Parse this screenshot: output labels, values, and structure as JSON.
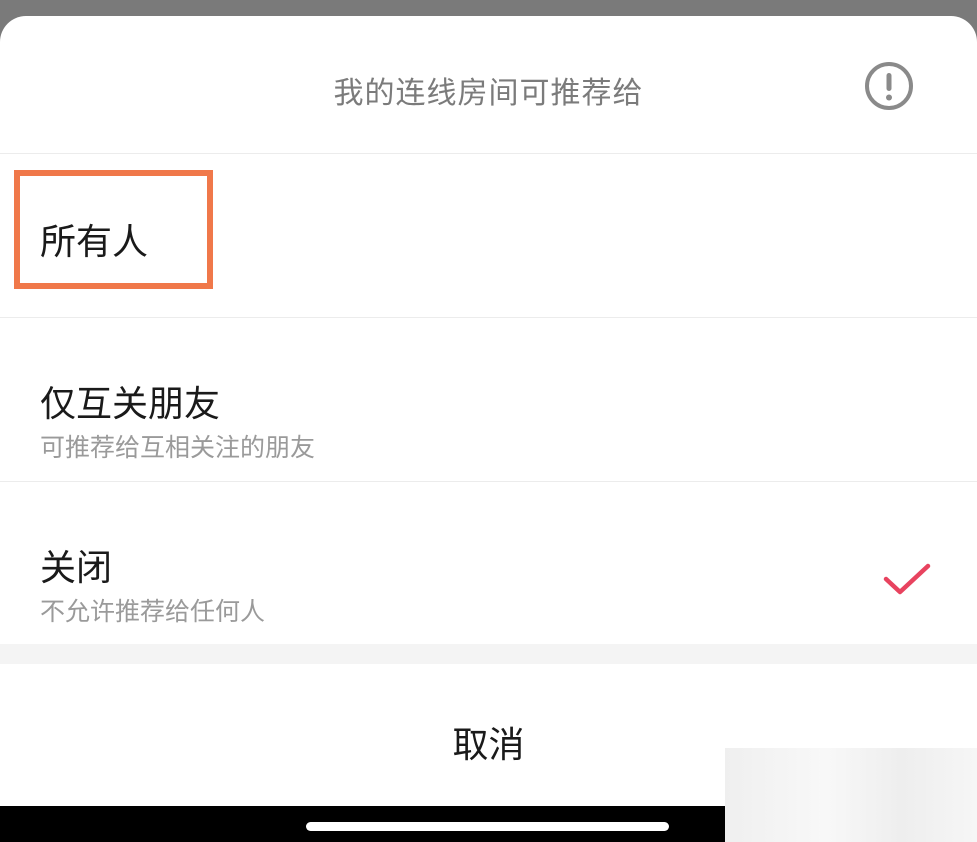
{
  "header": {
    "title": "我的连线房间可推荐给",
    "info_icon": "exclamation-circle-icon"
  },
  "options": [
    {
      "title": "所有人",
      "subtitle": "",
      "selected": false,
      "highlighted": true
    },
    {
      "title": "仅互关朋友",
      "subtitle": "可推荐给互相关注的朋友",
      "selected": false,
      "highlighted": false
    },
    {
      "title": "关闭",
      "subtitle": "不允许推荐给任何人",
      "selected": true,
      "highlighted": false
    }
  ],
  "check_icon": "checkmark-icon",
  "cancel_label": "取消",
  "colors": {
    "highlight": "#f0784a",
    "check": "#e8435f",
    "title_gray": "#7b7b7b"
  }
}
